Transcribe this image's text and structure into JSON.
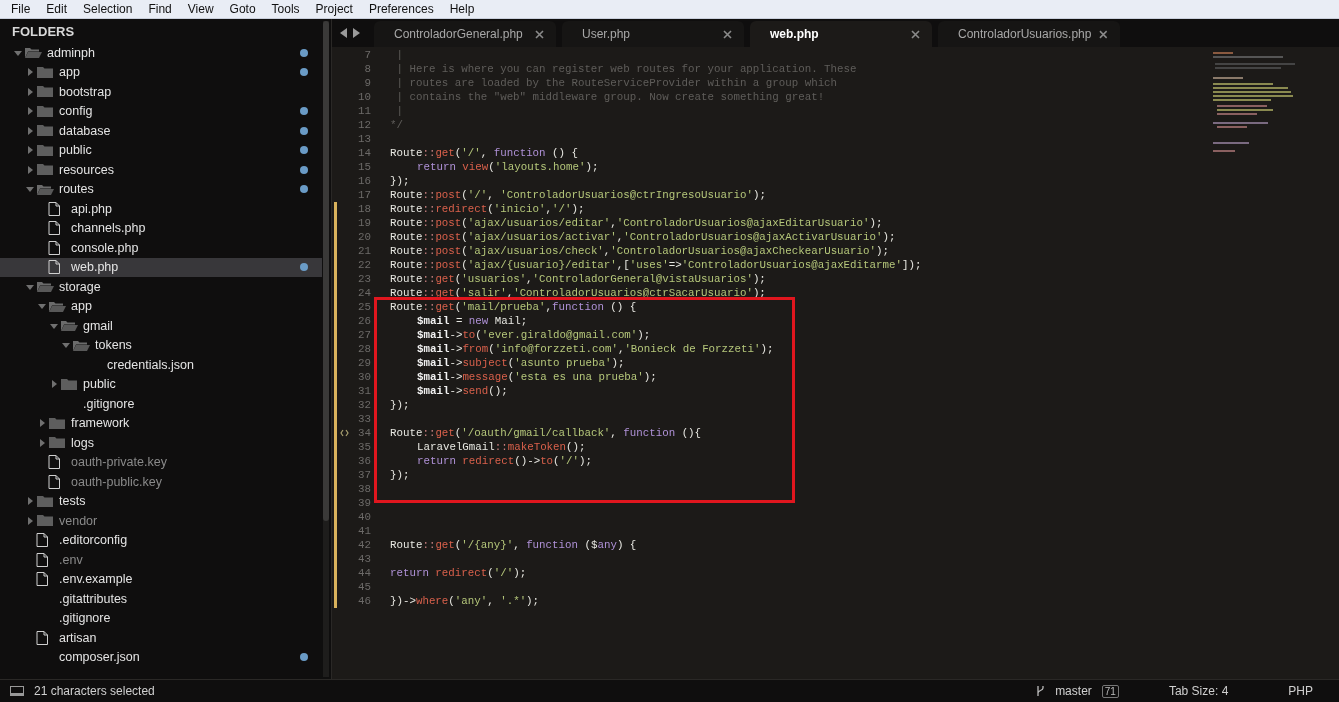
{
  "menu": [
    "File",
    "Edit",
    "Selection",
    "Find",
    "View",
    "Goto",
    "Tools",
    "Project",
    "Preferences",
    "Help"
  ],
  "sidebar": {
    "title": "FOLDERS",
    "tree": [
      {
        "kind": "folder",
        "name": "adminph",
        "expanded": true,
        "dot": true,
        "children": [
          {
            "kind": "folder",
            "name": "app",
            "expanded": false,
            "dot": true
          },
          {
            "kind": "folder",
            "name": "bootstrap",
            "expanded": false,
            "dot": false
          },
          {
            "kind": "folder",
            "name": "config",
            "expanded": false,
            "dot": true
          },
          {
            "kind": "folder",
            "name": "database",
            "expanded": false,
            "dot": true
          },
          {
            "kind": "folder",
            "name": "public",
            "expanded": false,
            "dot": true
          },
          {
            "kind": "folder",
            "name": "resources",
            "expanded": false,
            "dot": true
          },
          {
            "kind": "folder",
            "name": "routes",
            "expanded": true,
            "dot": true,
            "children": [
              {
                "kind": "file",
                "name": "api.php",
                "selected": false,
                "dot": false
              },
              {
                "kind": "file",
                "name": "channels.php",
                "selected": false,
                "dot": false
              },
              {
                "kind": "file",
                "name": "console.php",
                "selected": false,
                "dot": false
              },
              {
                "kind": "file",
                "name": "web.php",
                "selected": true,
                "dot": true
              }
            ]
          },
          {
            "kind": "folder",
            "name": "storage",
            "expanded": true,
            "dot": false,
            "children": [
              {
                "kind": "folder",
                "name": "app",
                "expanded": true,
                "dot": false,
                "children": [
                  {
                    "kind": "folder",
                    "name": "gmail",
                    "expanded": true,
                    "dot": false,
                    "children": [
                      {
                        "kind": "folder",
                        "name": "tokens",
                        "expanded": true,
                        "dot": false,
                        "children": [
                          {
                            "kind": "plain",
                            "name": "credentials.json",
                            "dim": false
                          }
                        ]
                      }
                    ]
                  },
                  {
                    "kind": "folder",
                    "name": "public",
                    "expanded": false,
                    "dot": false
                  },
                  {
                    "kind": "plain",
                    "name": ".gitignore",
                    "dim": false
                  }
                ]
              },
              {
                "kind": "folder",
                "name": "framework",
                "expanded": false,
                "dot": false
              },
              {
                "kind": "folder",
                "name": "logs",
                "expanded": false,
                "dot": false
              },
              {
                "kind": "file",
                "name": "oauth-private.key",
                "dim": true,
                "selected": false,
                "dot": false
              },
              {
                "kind": "file",
                "name": "oauth-public.key",
                "dim": true,
                "selected": false,
                "dot": false
              }
            ]
          },
          {
            "kind": "folder",
            "name": "tests",
            "expanded": false,
            "dot": false
          },
          {
            "kind": "folder",
            "name": "vendor",
            "expanded": false,
            "dim": true,
            "dot": false
          },
          {
            "kind": "file",
            "name": ".editorconfig",
            "selected": false,
            "dot": false
          },
          {
            "kind": "file",
            "name": ".env",
            "dim": true,
            "selected": false,
            "dot": false
          },
          {
            "kind": "file",
            "name": ".env.example",
            "selected": false,
            "dot": false
          },
          {
            "kind": "plain",
            "name": ".gitattributes",
            "dim": false
          },
          {
            "kind": "plain",
            "name": ".gitignore",
            "dim": false
          },
          {
            "kind": "file",
            "name": "artisan",
            "selected": false,
            "dot": false
          },
          {
            "kind": "plain",
            "name": "composer.json",
            "dim": false,
            "dot": true
          }
        ]
      }
    ]
  },
  "tabs": [
    {
      "label": "ControladorGeneral.php",
      "selected": false
    },
    {
      "label": "User.php",
      "selected": false
    },
    {
      "label": "web.php",
      "selected": true
    },
    {
      "label": "ControladorUsuarios.php",
      "selected": false
    }
  ],
  "code": {
    "lines": [
      {
        "n": "7",
        "modified": false,
        "boxed": false,
        "indented": false,
        "tokens": [
          {
            "kind": "comment",
            "text": " |"
          }
        ]
      },
      {
        "n": "8",
        "modified": false,
        "boxed": false,
        "indented": false,
        "tokens": [
          {
            "kind": "comment",
            "text": " | Here is where you can register web routes for your application. These"
          }
        ]
      },
      {
        "n": "9",
        "modified": false,
        "boxed": false,
        "indented": false,
        "tokens": [
          {
            "kind": "comment",
            "text": " | routes are loaded by the RouteServiceProvider within a group which"
          }
        ]
      },
      {
        "n": "10",
        "modified": false,
        "boxed": false,
        "indented": false,
        "tokens": [
          {
            "kind": "comment",
            "text": " | contains the \"web\" middleware group. Now create something great!"
          }
        ]
      },
      {
        "n": "11",
        "modified": false,
        "boxed": false,
        "indented": false,
        "tokens": [
          {
            "kind": "comment",
            "text": " |"
          }
        ]
      },
      {
        "n": "12",
        "modified": false,
        "boxed": false,
        "indented": false,
        "tokens": [
          {
            "kind": "comment",
            "text": "*/"
          }
        ]
      },
      {
        "n": "13",
        "modified": false,
        "boxed": false
      },
      {
        "n": "14",
        "modified": false,
        "boxed": false,
        "indented": false,
        "tokens": [
          {
            "kind": "plain",
            "text": "Route"
          },
          {
            "kind": "punct",
            "text": "::"
          },
          {
            "kind": "call",
            "text": "get"
          },
          {
            "kind": "plain",
            "text": "("
          },
          {
            "kind": "string",
            "text": "'/'"
          },
          {
            "kind": "plain",
            "text": ", "
          },
          {
            "kind": "keyword",
            "text": "function"
          },
          {
            "kind": "plain",
            "text": " () {"
          }
        ]
      },
      {
        "n": "15",
        "modified": false,
        "boxed": false,
        "indented": true,
        "tokens": [
          {
            "kind": "keyword",
            "text": "return"
          },
          {
            "kind": "call",
            "text": " view"
          },
          {
            "kind": "plain",
            "text": "("
          },
          {
            "kind": "string",
            "text": "'layouts.home'"
          },
          {
            "kind": "plain",
            "text": ");"
          }
        ]
      },
      {
        "n": "16",
        "modified": false,
        "boxed": false,
        "indented": false,
        "tokens": [
          {
            "kind": "plain",
            "text": "});"
          }
        ]
      },
      {
        "n": "17",
        "modified": false,
        "boxed": false,
        "indented": false,
        "tokens": [
          {
            "kind": "plain",
            "text": "Route"
          },
          {
            "kind": "punct",
            "text": "::"
          },
          {
            "kind": "call",
            "text": "post"
          },
          {
            "kind": "plain",
            "text": "("
          },
          {
            "kind": "string",
            "text": "'/'"
          },
          {
            "kind": "plain",
            "text": ", "
          },
          {
            "kind": "string",
            "text": "'ControladorUsuarios@ctrIngresoUsuario'"
          },
          {
            "kind": "plain",
            "text": ");"
          }
        ]
      },
      {
        "n": "18",
        "modified": true,
        "boxed": false,
        "indented": false,
        "tokens": [
          {
            "kind": "plain",
            "text": "Route"
          },
          {
            "kind": "punct",
            "text": "::"
          },
          {
            "kind": "call",
            "text": "redirect"
          },
          {
            "kind": "plain",
            "text": "("
          },
          {
            "kind": "string",
            "text": "'inicio'"
          },
          {
            "kind": "plain",
            "text": ","
          },
          {
            "kind": "string",
            "text": "'/'"
          },
          {
            "kind": "plain",
            "text": ");"
          }
        ]
      },
      {
        "n": "19",
        "modified": true,
        "boxed": false,
        "indented": false,
        "tokens": [
          {
            "kind": "plain",
            "text": "Route"
          },
          {
            "kind": "punct",
            "text": "::"
          },
          {
            "kind": "call",
            "text": "post"
          },
          {
            "kind": "plain",
            "text": "("
          },
          {
            "kind": "string",
            "text": "'ajax/usuarios/editar'"
          },
          {
            "kind": "plain",
            "text": ","
          },
          {
            "kind": "string",
            "text": "'ControladorUsuarios@ajaxEditarUsuario'"
          },
          {
            "kind": "plain",
            "text": ");"
          }
        ]
      },
      {
        "n": "20",
        "modified": true,
        "boxed": false,
        "indented": false,
        "tokens": [
          {
            "kind": "plain",
            "text": "Route"
          },
          {
            "kind": "punct",
            "text": "::"
          },
          {
            "kind": "call",
            "text": "post"
          },
          {
            "kind": "plain",
            "text": "("
          },
          {
            "kind": "string",
            "text": "'ajax/usuarios/activar'"
          },
          {
            "kind": "plain",
            "text": ","
          },
          {
            "kind": "string",
            "text": "'ControladorUsuarios@ajaxActivarUsuario'"
          },
          {
            "kind": "plain",
            "text": ");"
          }
        ]
      },
      {
        "n": "21",
        "modified": true,
        "boxed": false,
        "indented": false,
        "tokens": [
          {
            "kind": "plain",
            "text": "Route"
          },
          {
            "kind": "punct",
            "text": "::"
          },
          {
            "kind": "call",
            "text": "post"
          },
          {
            "kind": "plain",
            "text": "("
          },
          {
            "kind": "string",
            "text": "'ajax/usuarios/check'"
          },
          {
            "kind": "plain",
            "text": ","
          },
          {
            "kind": "string",
            "text": "'ControladorUsuarios@ajaxCheckearUsuario'"
          },
          {
            "kind": "plain",
            "text": ");"
          }
        ]
      },
      {
        "n": "22",
        "modified": true,
        "boxed": false,
        "indented": false,
        "tokens": [
          {
            "kind": "plain",
            "text": "Route"
          },
          {
            "kind": "punct",
            "text": "::"
          },
          {
            "kind": "call",
            "text": "post"
          },
          {
            "kind": "plain",
            "text": "("
          },
          {
            "kind": "string",
            "text": "'ajax/{usuario}/editar'"
          },
          {
            "kind": "plain",
            "text": ",["
          },
          {
            "kind": "string",
            "text": "'uses'"
          },
          {
            "kind": "plain",
            "text": "=>"
          },
          {
            "kind": "string",
            "text": "'ControladorUsuarios@ajaxEditarme'"
          },
          {
            "kind": "plain",
            "text": "]);"
          }
        ]
      },
      {
        "n": "23",
        "modified": true,
        "boxed": false,
        "indented": false,
        "tokens": [
          {
            "kind": "plain",
            "text": "Route"
          },
          {
            "kind": "punct",
            "text": "::"
          },
          {
            "kind": "call",
            "text": "get"
          },
          {
            "kind": "plain",
            "text": "("
          },
          {
            "kind": "string",
            "text": "'usuarios'"
          },
          {
            "kind": "plain",
            "text": ","
          },
          {
            "kind": "string",
            "text": "'ControladorGeneral@vistaUsuarios'"
          },
          {
            "kind": "plain",
            "text": ");"
          }
        ]
      },
      {
        "n": "24",
        "modified": true,
        "boxed": false,
        "indented": false,
        "tokens": [
          {
            "kind": "plain",
            "text": "Route"
          },
          {
            "kind": "punct",
            "text": "::"
          },
          {
            "kind": "call",
            "text": "get"
          },
          {
            "kind": "plain",
            "text": "("
          },
          {
            "kind": "string",
            "text": "'salir'"
          },
          {
            "kind": "plain",
            "text": ","
          },
          {
            "kind": "string",
            "text": "'ControladorUsuarios@ctrSacarUsuario'"
          },
          {
            "kind": "plain",
            "text": ");"
          }
        ]
      },
      {
        "n": "25",
        "modified": true,
        "boxed": true,
        "indented": false,
        "tokens": [
          {
            "kind": "plain",
            "text": "Route"
          },
          {
            "kind": "punct",
            "text": "::"
          },
          {
            "kind": "call",
            "text": "get"
          },
          {
            "kind": "plain",
            "text": "("
          },
          {
            "kind": "string",
            "text": "'mail/prueba'"
          },
          {
            "kind": "plain",
            "text": ","
          },
          {
            "kind": "keyword",
            "text": "function"
          },
          {
            "kind": "plain",
            "text": " () {"
          }
        ]
      },
      {
        "n": "26",
        "modified": true,
        "boxed": true,
        "indented": true,
        "tokens": [
          {
            "kind": "var",
            "text": "$mail"
          },
          {
            "kind": "plain",
            "text": " = "
          },
          {
            "kind": "keyword",
            "text": "new"
          },
          {
            "kind": "plain",
            "text": " Mail;"
          }
        ]
      },
      {
        "n": "27",
        "modified": true,
        "boxed": true,
        "indented": true,
        "tokens": [
          {
            "kind": "var",
            "text": "$mail"
          },
          {
            "kind": "plain",
            "text": "->"
          },
          {
            "kind": "call",
            "text": "to"
          },
          {
            "kind": "plain",
            "text": "("
          },
          {
            "kind": "string",
            "text": "'ever.giraldo@gmail.com'"
          },
          {
            "kind": "plain",
            "text": ");"
          }
        ]
      },
      {
        "n": "28",
        "modified": true,
        "boxed": true,
        "indented": true,
        "tokens": [
          {
            "kind": "var",
            "text": "$mail"
          },
          {
            "kind": "plain",
            "text": "->"
          },
          {
            "kind": "call",
            "text": "from"
          },
          {
            "kind": "plain",
            "text": "("
          },
          {
            "kind": "string",
            "text": "'info@forzzeti.com'"
          },
          {
            "kind": "plain",
            "text": ","
          },
          {
            "kind": "string",
            "text": "'Bonieck de Forzzeti'"
          },
          {
            "kind": "plain",
            "text": ");"
          }
        ]
      },
      {
        "n": "29",
        "modified": true,
        "boxed": true,
        "indented": true,
        "tokens": [
          {
            "kind": "var",
            "text": "$mail"
          },
          {
            "kind": "plain",
            "text": "->"
          },
          {
            "kind": "call",
            "text": "subject"
          },
          {
            "kind": "plain",
            "text": "("
          },
          {
            "kind": "string",
            "text": "'asunto prueba'"
          },
          {
            "kind": "plain",
            "text": ");"
          }
        ]
      },
      {
        "n": "30",
        "modified": true,
        "boxed": true,
        "indented": true,
        "tokens": [
          {
            "kind": "var",
            "text": "$mail"
          },
          {
            "kind": "plain",
            "text": "->"
          },
          {
            "kind": "call",
            "text": "message"
          },
          {
            "kind": "plain",
            "text": "("
          },
          {
            "kind": "string",
            "text": "'esta es una prueba'"
          },
          {
            "kind": "plain",
            "text": ");"
          }
        ]
      },
      {
        "n": "31",
        "modified": true,
        "boxed": true,
        "indented": true,
        "tokens": [
          {
            "kind": "var",
            "text": "$mail"
          },
          {
            "kind": "plain",
            "text": "->"
          },
          {
            "kind": "call",
            "text": "send"
          },
          {
            "kind": "plain",
            "text": "();"
          }
        ]
      },
      {
        "n": "32",
        "modified": true,
        "boxed": true,
        "indented": false,
        "tokens": [
          {
            "kind": "plain",
            "text": "});"
          }
        ]
      },
      {
        "n": "33",
        "modified": true,
        "boxed": true
      },
      {
        "n": "34",
        "modified": true,
        "boxed": true,
        "indented": false,
        "marker": true,
        "tokens": [
          {
            "kind": "plain",
            "text": "Route"
          },
          {
            "kind": "punct",
            "text": "::"
          },
          {
            "kind": "call",
            "text": "get"
          },
          {
            "kind": "plain",
            "text": "("
          },
          {
            "kind": "string",
            "text": "'/oauth/gmail/callback'"
          },
          {
            "kind": "plain",
            "text": ", "
          },
          {
            "kind": "keyword",
            "text": "function"
          },
          {
            "kind": "plain",
            "text": " (){"
          }
        ]
      },
      {
        "n": "35",
        "modified": true,
        "boxed": true,
        "indented": true,
        "tokens": [
          {
            "kind": "plain",
            "text": "LaravelGmail"
          },
          {
            "kind": "punct",
            "text": "::"
          },
          {
            "kind": "call",
            "text": "makeToken"
          },
          {
            "kind": "plain",
            "text": "();"
          }
        ]
      },
      {
        "n": "36",
        "modified": true,
        "boxed": true,
        "indented": true,
        "tokens": [
          {
            "kind": "keyword",
            "text": "return"
          },
          {
            "kind": "call",
            "text": " redirect"
          },
          {
            "kind": "plain",
            "text": "()->"
          },
          {
            "kind": "call",
            "text": "to"
          },
          {
            "kind": "plain",
            "text": "("
          },
          {
            "kind": "string",
            "text": "'/'"
          },
          {
            "kind": "plain",
            "text": ");"
          }
        ]
      },
      {
        "n": "37",
        "modified": true,
        "boxed": true,
        "indented": false,
        "tokens": [
          {
            "kind": "plain",
            "text": "});"
          }
        ]
      },
      {
        "n": "38",
        "modified": true,
        "boxed": true
      },
      {
        "n": "39",
        "modified": true,
        "boxed": false
      },
      {
        "n": "40",
        "modified": true,
        "boxed": false
      },
      {
        "n": "41",
        "modified": true,
        "boxed": false
      },
      {
        "n": "42",
        "modified": true,
        "boxed": false,
        "indented": false,
        "tokens": [
          {
            "kind": "plain",
            "text": "Route"
          },
          {
            "kind": "punct",
            "text": "::"
          },
          {
            "kind": "call",
            "text": "get"
          },
          {
            "kind": "plain",
            "text": "("
          },
          {
            "kind": "string",
            "text": "'/{any}'"
          },
          {
            "kind": "plain",
            "text": ", "
          },
          {
            "kind": "keyword",
            "text": "function"
          },
          {
            "kind": "plain",
            "text": " ($"
          },
          {
            "kind": "keyword",
            "text": "any"
          },
          {
            "kind": "plain",
            "text": ") {"
          }
        ]
      },
      {
        "n": "43",
        "modified": true,
        "boxed": false
      },
      {
        "n": "44",
        "modified": true,
        "boxed": false,
        "indented": false,
        "tokens": [
          {
            "kind": "keyword",
            "text": "return"
          },
          {
            "kind": "call",
            "text": " redirect"
          },
          {
            "kind": "plain",
            "text": "("
          },
          {
            "kind": "string",
            "text": "'/'"
          },
          {
            "kind": "plain",
            "text": ");"
          }
        ]
      },
      {
        "n": "45",
        "modified": true,
        "boxed": false
      },
      {
        "n": "46",
        "modified": true,
        "boxed": false,
        "indented": false,
        "tokens": [
          {
            "kind": "plain",
            "text": "})->"
          },
          {
            "kind": "call",
            "text": "where"
          },
          {
            "kind": "plain",
            "text": "("
          },
          {
            "kind": "string",
            "text": "'any'"
          },
          {
            "kind": "plain",
            "text": ", "
          },
          {
            "kind": "string",
            "text": "'.*'"
          },
          {
            "kind": "plain",
            "text": ");"
          }
        ]
      }
    ]
  },
  "status_bar": {
    "selection": "21 characters selected",
    "branch": "master",
    "branch_count": "71",
    "tab_size": "Tab Size: 4",
    "syntax": "PHP"
  }
}
